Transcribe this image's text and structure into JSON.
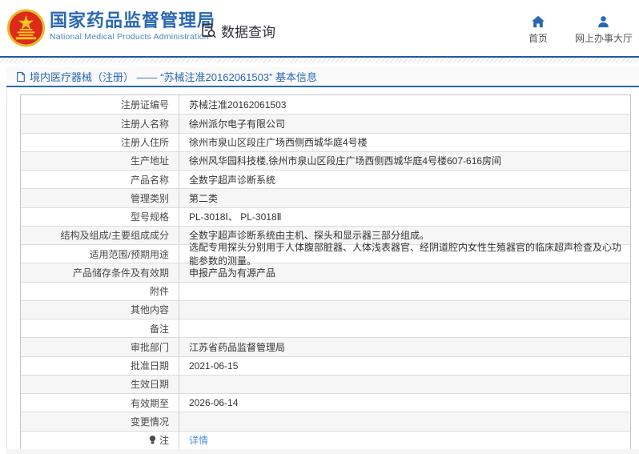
{
  "header": {
    "org_name_cn": "国家药品监督管理局",
    "org_name_en": "National Medical Products Administration",
    "data_query_label": "数据查询",
    "nav": [
      {
        "label": "首页",
        "icon": "home-icon"
      },
      {
        "label": "网上办事大厅",
        "icon": "user-icon"
      }
    ]
  },
  "breadcrumb": {
    "title": "境内医疗器械（注册） —— “苏械注准20162061503” 基本信息",
    "icon": "document-icon"
  },
  "table": {
    "rows": [
      {
        "label": "注册证编号",
        "value": "苏械注准20162061503"
      },
      {
        "label": "注册人名称",
        "value": "徐州派尔电子有限公司"
      },
      {
        "label": "注册人住所",
        "value": "徐州市泉山区段庄广场西侧西城华庭4号楼"
      },
      {
        "label": "生产地址",
        "value": "徐州风华园科技楼,徐州市泉山区段庄广场西侧西城华庭4号楼607-616房间"
      },
      {
        "label": "产品名称",
        "value": "全数字超声诊断系统"
      },
      {
        "label": "管理类别",
        "value": "第二类"
      },
      {
        "label": "型号规格",
        "value": "PL-3018Ⅰ、 PL-3018Ⅱ"
      },
      {
        "label": "结构及组成/主要组成成分",
        "value": "全数字超声诊断系统由主机、探头和显示器三部分组成。"
      },
      {
        "label": "适用范围/预期用途",
        "value": "选配专用探头分别用于人体腹部脏器、人体浅表器官、经阴道腔内女性生殖器官的临床超声检查及心功能参数的测量。"
      },
      {
        "label": "产品储存条件及有效期",
        "value": "申报产品为有源产品"
      },
      {
        "label": "附件",
        "value": ""
      },
      {
        "label": "其他内容",
        "value": ""
      },
      {
        "label": "备注",
        "value": ""
      },
      {
        "label": "审批部门",
        "value": "江苏省药品监督管理局"
      },
      {
        "label": "批准日期",
        "value": "2021-06-15"
      },
      {
        "label": "生效日期",
        "value": ""
      },
      {
        "label": "有效期至",
        "value": "2026-06-14"
      },
      {
        "label": "变更情况",
        "value": ""
      },
      {
        "label": "注",
        "value": "详情",
        "link": true,
        "icon": "bulb-icon"
      }
    ]
  },
  "colors": {
    "accent_blue": "#2a68b2",
    "line_blue": "#1e5aa5",
    "link_blue": "#4a90d9",
    "row_alt_bg": "#f6f6f6",
    "emblem_red": "#dd2a1b",
    "emblem_gold": "#f0b91f"
  }
}
